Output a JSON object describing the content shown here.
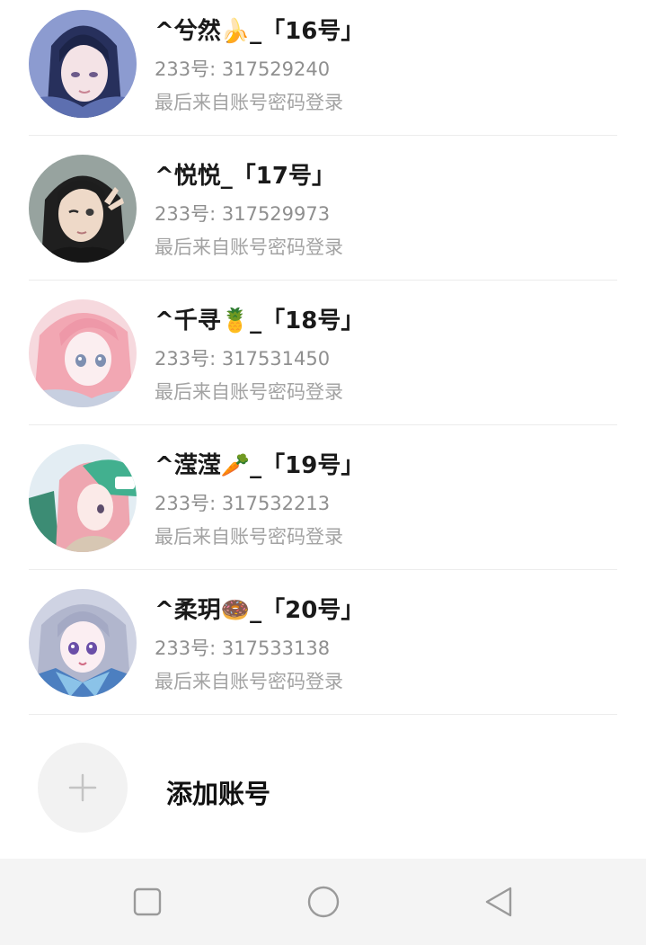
{
  "accounts": [
    {
      "name": "^兮然🍌_「16号」",
      "uid_label": "233号",
      "uid": "317529240",
      "login_source": "最后来自账号密码登录",
      "avatar_icon": "anime-girl-dark-hair-avatar",
      "colors": [
        "#3d4f86",
        "#a9b6e0",
        "#1c2448"
      ]
    },
    {
      "name": "^悦悦_「17号」",
      "uid_label": "233号",
      "uid": "317529973",
      "login_source": "最后来自账号密码登录",
      "avatar_icon": "girl-winking-peace-avatar",
      "colors": [
        "#9aa6a2",
        "#e8d6c6",
        "#1d1d1d"
      ]
    },
    {
      "name": "^千寻🍍_「18号」",
      "uid_label": "233号",
      "uid": "317531450",
      "login_source": "最后来自账号密码登录",
      "avatar_icon": "anime-girl-pink-hair-avatar",
      "colors": [
        "#f3b6bf",
        "#fde6ea",
        "#c7cfe0"
      ]
    },
    {
      "name": "^滢滢🥕_「19号」",
      "uid_label": "233号",
      "uid": "317532213",
      "login_source": "最后来自账号密码登录",
      "avatar_icon": "anime-girl-green-cap-avatar",
      "colors": [
        "#f0b7bd",
        "#3fa68a",
        "#e6eef4"
      ]
    },
    {
      "name": "^柔玥🍩_「20号」",
      "uid_label": "233号",
      "uid": "317533138",
      "login_source": "最后来自账号密码登录",
      "avatar_icon": "anime-girl-silver-hair-avatar",
      "colors": [
        "#b7bcd4",
        "#4c7fc0",
        "#e7e2ef"
      ]
    }
  ],
  "add_account": {
    "label": "添加账号",
    "icon": "plus-icon"
  },
  "nav_bar": {
    "recent_icon": "square-icon",
    "home_icon": "circle-icon",
    "back_icon": "triangle-back-icon"
  }
}
